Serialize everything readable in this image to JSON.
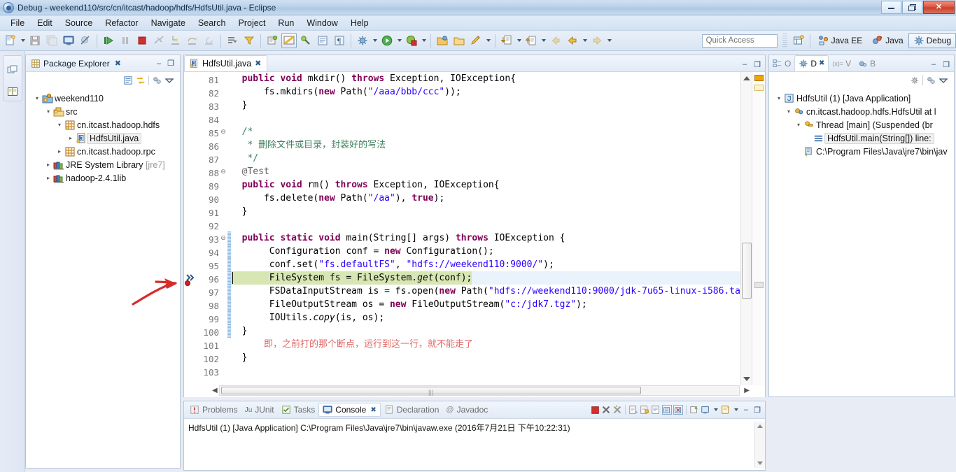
{
  "window": {
    "title": "Debug - weekend110/src/cn/itcast/hadoop/hdfs/HdfsUtil.java - Eclipse",
    "app_icon": "eclipse-icon",
    "minimize_label": "–",
    "restore_label": "❐",
    "close_label": "✕"
  },
  "menubar": {
    "items": [
      {
        "label": "File"
      },
      {
        "label": "Edit"
      },
      {
        "label": "Source"
      },
      {
        "label": "Refactor"
      },
      {
        "label": "Navigate"
      },
      {
        "label": "Search"
      },
      {
        "label": "Project"
      },
      {
        "label": "Run"
      },
      {
        "label": "Window"
      },
      {
        "label": "Help"
      }
    ]
  },
  "toolbar": {
    "icons": [
      {
        "name": "new-wizard-icon"
      },
      {
        "name": "save-icon"
      },
      {
        "name": "save-all-icon"
      },
      {
        "name": "console-icon"
      },
      {
        "name": "skip-breakpoints-icon"
      },
      {
        "name": "resume-icon"
      },
      {
        "name": "suspend-icon"
      },
      {
        "name": "terminate-icon"
      },
      {
        "name": "disconnect-icon"
      },
      {
        "name": "step-into-icon"
      },
      {
        "name": "step-over-icon"
      },
      {
        "name": "step-return-icon"
      },
      {
        "name": "drop-to-frame-icon"
      },
      {
        "name": "use-step-filters-icon"
      },
      {
        "name": "new-java-project-icon"
      },
      {
        "name": "open-type-icon"
      },
      {
        "name": "toggle-mark-occurrences-icon"
      },
      {
        "name": "external-tools-icon"
      },
      {
        "name": "search-icon"
      },
      {
        "name": "pilcrow-icon"
      },
      {
        "name": "debug-run-icon"
      },
      {
        "name": "run-icon"
      },
      {
        "name": "coverage-icon"
      },
      {
        "name": "new-package-icon"
      },
      {
        "name": "open-folder-icon"
      },
      {
        "name": "edit-icon"
      },
      {
        "name": "next-annotation-icon"
      },
      {
        "name": "previous-annotation-icon"
      },
      {
        "name": "back-icon"
      },
      {
        "name": "back-history-icon"
      },
      {
        "name": "forward-icon"
      }
    ],
    "quick_access_placeholder": "Quick Access",
    "perspectives": [
      {
        "label": "Java EE",
        "icon": "java-ee-perspective-icon",
        "active": false
      },
      {
        "label": "Java",
        "icon": "java-perspective-icon",
        "active": false
      },
      {
        "label": "Debug",
        "icon": "debug-perspective-icon",
        "active": true
      }
    ],
    "open_perspective_icon": "open-perspective-icon"
  },
  "left_rail": {
    "icons": [
      {
        "name": "restore-view-icon"
      },
      {
        "name": "outline-view-icon"
      }
    ]
  },
  "package_explorer": {
    "title": "Package Explorer",
    "close_label": "✖",
    "minimize_label": "–",
    "maximize_label": "❐",
    "toolbar_icons": [
      {
        "name": "collapse-all-icon"
      },
      {
        "name": "link-with-editor-icon"
      },
      {
        "name": "focus-on-active-task-icon"
      },
      {
        "name": "view-menu-icon"
      }
    ],
    "tree": [
      {
        "label": "weekend110",
        "indent": 0,
        "twisty": "▾",
        "icon": "java-project-icon",
        "selected": false
      },
      {
        "label": "src",
        "indent": 1,
        "twisty": "▾",
        "icon": "source-folder-icon",
        "selected": false
      },
      {
        "label": "cn.itcast.hadoop.hdfs",
        "indent": 2,
        "twisty": "▾",
        "icon": "package-icon",
        "selected": false
      },
      {
        "label": "HdfsUtil.java",
        "indent": 3,
        "twisty": "▸",
        "icon": "java-file-icon",
        "selected": true
      },
      {
        "label": "cn.itcast.hadoop.rpc",
        "indent": 2,
        "twisty": "▸",
        "icon": "package-icon",
        "selected": false
      },
      {
        "label": "JRE System Library",
        "suffix": "[jre7]",
        "indent": 1,
        "twisty": "▸",
        "icon": "library-icon",
        "selected": false
      },
      {
        "label": "hadoop-2.4.1lib",
        "indent": 1,
        "twisty": "▸",
        "icon": "library-icon",
        "selected": false
      }
    ]
  },
  "editor": {
    "tab": {
      "label": "HdfsUtil.java",
      "icon": "java-file-icon",
      "close_label": "✖"
    },
    "minimize_label": "–",
    "maximize_label": "❐",
    "current_line": 96,
    "breakpoint_line": 96,
    "lines": [
      {
        "n": 81,
        "fold": "",
        "marker": "",
        "tokens": [
          {
            "t": "  ",
            "c": ""
          },
          {
            "t": "public",
            "c": "kw"
          },
          {
            "t": " ",
            "c": ""
          },
          {
            "t": "void",
            "c": "kw"
          },
          {
            "t": " mkdir() ",
            "c": ""
          },
          {
            "t": "throws",
            "c": "kw"
          },
          {
            "t": " Exception, IOException{",
            "c": ""
          }
        ]
      },
      {
        "n": 82,
        "fold": "",
        "marker": "",
        "tokens": [
          {
            "t": "      fs.mkdirs(",
            "c": ""
          },
          {
            "t": "new",
            "c": "kw"
          },
          {
            "t": " Path(",
            "c": ""
          },
          {
            "t": "\"/aaa/bbb/ccc\"",
            "c": "str"
          },
          {
            "t": "));",
            "c": ""
          }
        ]
      },
      {
        "n": 83,
        "fold": "",
        "marker": "",
        "tokens": [
          {
            "t": "  }",
            "c": ""
          }
        ]
      },
      {
        "n": 84,
        "fold": "",
        "marker": "",
        "tokens": [
          {
            "t": "",
            "c": ""
          }
        ]
      },
      {
        "n": 85,
        "fold": "⊖",
        "marker": "",
        "tokens": [
          {
            "t": "  /*",
            "c": "cmt"
          }
        ]
      },
      {
        "n": 86,
        "fold": "",
        "marker": "",
        "tokens": [
          {
            "t": "   * 删除文件或目录，封装好的写法",
            "c": "cmt"
          }
        ]
      },
      {
        "n": 87,
        "fold": "",
        "marker": "",
        "tokens": [
          {
            "t": "   */",
            "c": "cmt"
          }
        ]
      },
      {
        "n": 88,
        "fold": "⊖",
        "marker": "",
        "tokens": [
          {
            "t": "  @Test",
            "c": "ann"
          }
        ]
      },
      {
        "n": 89,
        "fold": "",
        "marker": "",
        "tokens": [
          {
            "t": "  ",
            "c": ""
          },
          {
            "t": "public",
            "c": "kw"
          },
          {
            "t": " ",
            "c": ""
          },
          {
            "t": "void",
            "c": "kw"
          },
          {
            "t": " rm() ",
            "c": ""
          },
          {
            "t": "throws",
            "c": "kw"
          },
          {
            "t": " Exception, IOException{",
            "c": ""
          }
        ]
      },
      {
        "n": 90,
        "fold": "",
        "marker": "",
        "tokens": [
          {
            "t": "      fs.delete(",
            "c": ""
          },
          {
            "t": "new",
            "c": "kw"
          },
          {
            "t": " Path(",
            "c": ""
          },
          {
            "t": "\"/aa\"",
            "c": "str"
          },
          {
            "t": "), ",
            "c": ""
          },
          {
            "t": "true",
            "c": "kw"
          },
          {
            "t": ");",
            "c": ""
          }
        ]
      },
      {
        "n": 91,
        "fold": "",
        "marker": "",
        "tokens": [
          {
            "t": "  }",
            "c": ""
          }
        ]
      },
      {
        "n": 92,
        "fold": "",
        "marker": "",
        "tokens": [
          {
            "t": "",
            "c": ""
          }
        ]
      },
      {
        "n": 93,
        "fold": "⊖",
        "marker": "",
        "tokens": [
          {
            "t": "  ",
            "c": ""
          },
          {
            "t": "public",
            "c": "kw"
          },
          {
            "t": " ",
            "c": ""
          },
          {
            "t": "static",
            "c": "kw"
          },
          {
            "t": " ",
            "c": ""
          },
          {
            "t": "void",
            "c": "kw"
          },
          {
            "t": " main(String[] args) ",
            "c": ""
          },
          {
            "t": "throws",
            "c": "kw"
          },
          {
            "t": " IOException {",
            "c": ""
          }
        ]
      },
      {
        "n": 94,
        "fold": "",
        "marker": "",
        "tokens": [
          {
            "t": "       Configuration conf = ",
            "c": ""
          },
          {
            "t": "new",
            "c": "kw"
          },
          {
            "t": " Configuration();",
            "c": ""
          }
        ]
      },
      {
        "n": 95,
        "fold": "",
        "marker": "",
        "tokens": [
          {
            "t": "       conf.set(",
            "c": ""
          },
          {
            "t": "\"fs.defaultFS\"",
            "c": "str"
          },
          {
            "t": ", ",
            "c": ""
          },
          {
            "t": "\"hdfs://weekend110:9000/\"",
            "c": "str"
          },
          {
            "t": ");",
            "c": ""
          }
        ]
      },
      {
        "n": 96,
        "fold": "",
        "marker": "current-instruction-pointer",
        "highlight": true,
        "tokens": [
          {
            "t": "       FileSystem fs = FileSystem.",
            "c": ""
          },
          {
            "t": "get",
            "c": "stat"
          },
          {
            "t": "(conf);",
            "c": ""
          }
        ]
      },
      {
        "n": 97,
        "fold": "",
        "marker": "",
        "tokens": [
          {
            "t": "       FSDataInputStream is = fs.open(",
            "c": ""
          },
          {
            "t": "new",
            "c": "kw"
          },
          {
            "t": " Path(",
            "c": ""
          },
          {
            "t": "\"hdfs://weekend110:9000/jdk-7u65-linux-i586.ta",
            "c": "str"
          }
        ]
      },
      {
        "n": 98,
        "fold": "",
        "marker": "",
        "tokens": [
          {
            "t": "       FileOutputStream os = ",
            "c": ""
          },
          {
            "t": "new",
            "c": "kw"
          },
          {
            "t": " FileOutputStream(",
            "c": ""
          },
          {
            "t": "\"c:/jdk7.tgz\"",
            "c": "str"
          },
          {
            "t": ");",
            "c": ""
          }
        ]
      },
      {
        "n": 99,
        "fold": "",
        "marker": "",
        "tokens": [
          {
            "t": "       IOUtils.",
            "c": ""
          },
          {
            "t": "copy",
            "c": "stat"
          },
          {
            "t": "(is, os);",
            "c": ""
          }
        ]
      },
      {
        "n": 100,
        "fold": "",
        "marker": "",
        "tokens": [
          {
            "t": "  }",
            "c": ""
          }
        ]
      },
      {
        "n": 101,
        "fold": "",
        "marker": "",
        "tokens": [
          {
            "t": "      即，之前打的那个断点，运行到这一行，就不能走了",
            "c": "redtxt"
          }
        ]
      },
      {
        "n": 102,
        "fold": "",
        "marker": "",
        "tokens": [
          {
            "t": "  }",
            "c": ""
          }
        ]
      },
      {
        "n": 103,
        "fold": "",
        "marker": "",
        "tokens": [
          {
            "t": "",
            "c": ""
          }
        ]
      }
    ]
  },
  "debug_view": {
    "tabs": [
      {
        "label": "O",
        "icon": "outline-icon",
        "active": false
      },
      {
        "label": "D",
        "icon": "debug-icon",
        "active": true,
        "close_label": "✖"
      },
      {
        "label": "V",
        "icon": "variables-icon",
        "active": false
      },
      {
        "label": "B",
        "icon": "breakpoints-icon",
        "active": false
      }
    ],
    "minimize_label": "–",
    "maximize_label": "❐",
    "toolbar_icons": [
      {
        "name": "debug-filter-icon"
      },
      {
        "name": "link-debug-icon"
      },
      {
        "name": "view-menu-icon"
      }
    ],
    "tree": [
      {
        "label": "HdfsUtil (1) [Java Application]",
        "indent": 0,
        "twisty": "▾",
        "icon": "launch-config-icon",
        "selected": false
      },
      {
        "label": "cn.itcast.hadoop.hdfs.HdfsUtil at l",
        "indent": 1,
        "twisty": "▾",
        "icon": "debug-target-icon",
        "selected": false
      },
      {
        "label": "Thread [main] (Suspended (br",
        "indent": 2,
        "twisty": "▾",
        "icon": "thread-icon",
        "selected": false
      },
      {
        "label": "HdfsUtil.main(String[]) line:",
        "indent": 3,
        "twisty": "",
        "icon": "stack-frame-icon",
        "selected": true
      },
      {
        "label": "C:\\Program Files\\Java\\jre7\\bin\\jav",
        "indent": 2,
        "twisty": "",
        "icon": "system-process-icon",
        "selected": false
      }
    ]
  },
  "console": {
    "tabs": [
      {
        "label": "Problems",
        "icon": "problems-icon",
        "active": false
      },
      {
        "label": "JUnit",
        "icon": "junit-icon",
        "active": false
      },
      {
        "label": "Tasks",
        "icon": "tasks-icon",
        "active": false
      },
      {
        "label": "Console",
        "icon": "console-icon",
        "active": true,
        "close_label": "✖"
      },
      {
        "label": "Declaration",
        "icon": "declaration-icon",
        "active": false
      },
      {
        "label": "Javadoc",
        "icon": "javadoc-icon",
        "active": false
      }
    ],
    "toolbar_icons": [
      {
        "name": "terminate-icon"
      },
      {
        "name": "remove-launch-icon"
      },
      {
        "name": "remove-all-terminated-icon"
      },
      {
        "name": "clear-console-icon"
      },
      {
        "name": "scroll-lock-icon"
      },
      {
        "name": "word-wrap-icon"
      },
      {
        "name": "pin-console-icon"
      },
      {
        "name": "display-selected-console-icon"
      },
      {
        "name": "open-console-icon"
      },
      {
        "name": "console-dropdown-icon"
      },
      {
        "name": "new-console-view-icon"
      },
      {
        "name": "new-console-dropdown-icon"
      }
    ],
    "minimize_label": "–",
    "maximize_label": "❐",
    "status_line": "HdfsUtil (1) [Java Application] C:\\Program Files\\Java\\jre7\\bin\\javaw.exe (2016年7月21日 下午10:22:31)"
  },
  "annotation": {
    "name": "red-arrow-pointing-to-line-96",
    "color": "#d82b2b",
    "target_line": 96
  },
  "colors": {
    "keyword": "#7f0055",
    "string": "#2a00ff",
    "comment": "#3f7f5f",
    "annotation_text": "#e06666",
    "current_line_highlight": "#d7e6b3",
    "selection": "#eaf2fb",
    "chrome": "#dae5f3"
  }
}
